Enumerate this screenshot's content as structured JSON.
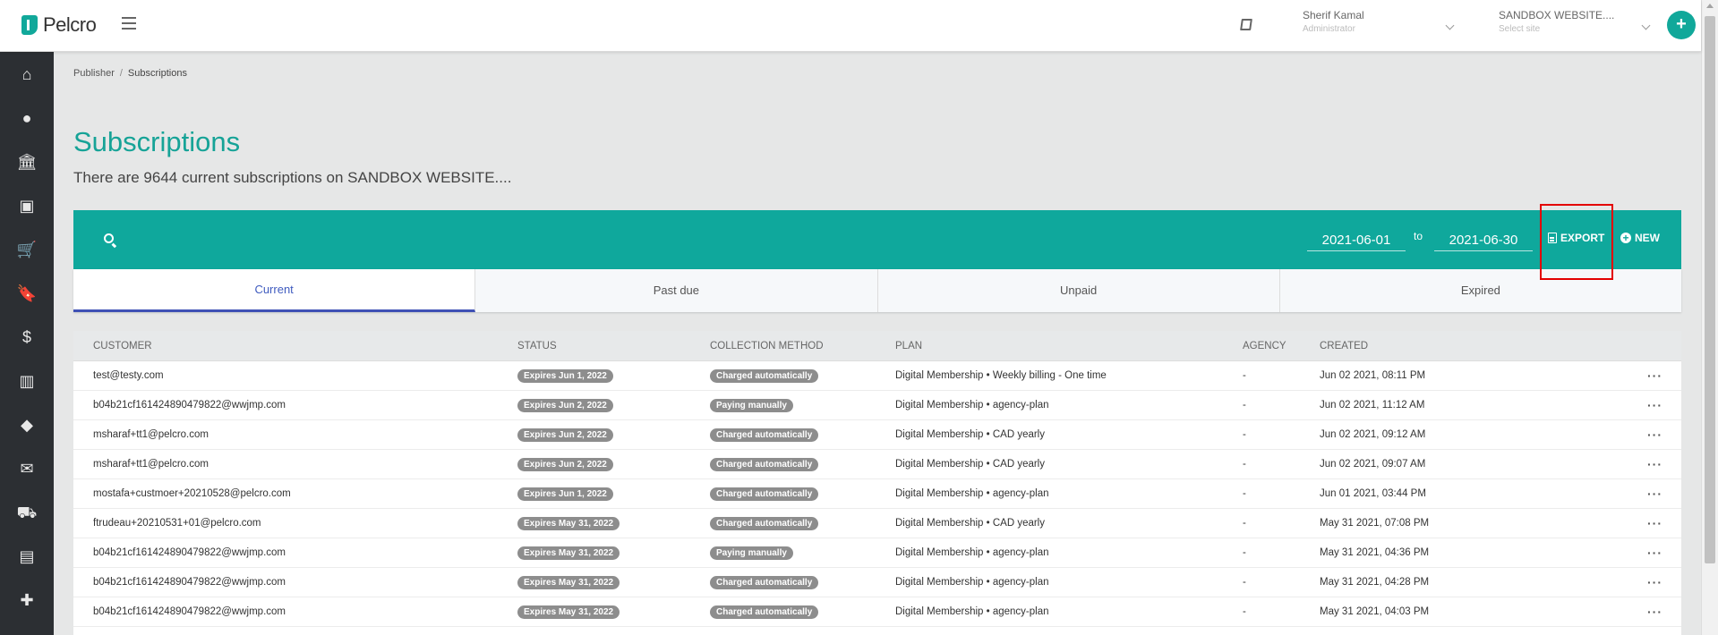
{
  "app": {
    "logo_text": "Pelcro"
  },
  "header": {
    "user_name": "Sherif Kamal",
    "user_role": "Administrator",
    "site_name": "SANDBOX WEBSITE....",
    "site_placeholder": "Select site",
    "add_label": "+"
  },
  "sidebar": {
    "items": [
      {
        "name": "home",
        "glyph": "⌂"
      },
      {
        "name": "user",
        "glyph": "●"
      },
      {
        "name": "bank",
        "glyph": "🏛"
      },
      {
        "name": "briefcase",
        "glyph": "▣"
      },
      {
        "name": "cart",
        "glyph": "🛒"
      },
      {
        "name": "bookmark",
        "glyph": "🔖"
      },
      {
        "name": "dollar",
        "glyph": "$"
      },
      {
        "name": "chart",
        "glyph": "▥"
      },
      {
        "name": "tag",
        "glyph": "◆"
      },
      {
        "name": "mail",
        "glyph": "✉"
      },
      {
        "name": "truck",
        "glyph": "⛟"
      },
      {
        "name": "store",
        "glyph": "▤"
      },
      {
        "name": "puzzle",
        "glyph": "✚"
      }
    ]
  },
  "breadcrumb": {
    "parent": "Publisher",
    "separator": "/",
    "current": "Subscriptions"
  },
  "page": {
    "title": "Subscriptions",
    "subtitle": "There are 9644 current subscriptions on SANDBOX WEBSITE...."
  },
  "toolbar": {
    "date_from": "2021-06-01",
    "to_label": "to",
    "date_to": "2021-06-30",
    "export_label": "EXPORT",
    "new_label": "NEW"
  },
  "tabs": [
    {
      "label": "Current",
      "active": true
    },
    {
      "label": "Past due",
      "active": false
    },
    {
      "label": "Unpaid",
      "active": false
    },
    {
      "label": "Expired",
      "active": false
    }
  ],
  "table": {
    "headers": {
      "customer": "CUSTOMER",
      "status": "STATUS",
      "method": "COLLECTION METHOD",
      "plan": "PLAN",
      "agency": "AGENCY",
      "created": "CREATED"
    },
    "rows": [
      {
        "customer": "test@testy.com",
        "status": "Expires Jun 1, 2022",
        "method": "Charged automatically",
        "plan": "Digital Membership • Weekly billing - One time",
        "agency": "-",
        "created": "Jun 02 2021, 08:11 PM"
      },
      {
        "customer": "b04b21cf161424890479822@wwjmp.com",
        "status": "Expires Jun 2, 2022",
        "method": "Paying manually",
        "plan": "Digital Membership • agency-plan",
        "agency": "-",
        "created": "Jun 02 2021, 11:12 AM"
      },
      {
        "customer": "msharaf+tt1@pelcro.com",
        "status": "Expires Jun 2, 2022",
        "method": "Charged automatically",
        "plan": "Digital Membership • CAD yearly",
        "agency": "-",
        "created": "Jun 02 2021, 09:12 AM"
      },
      {
        "customer": "msharaf+tt1@pelcro.com",
        "status": "Expires Jun 2, 2022",
        "method": "Charged automatically",
        "plan": "Digital Membership • CAD yearly",
        "agency": "-",
        "created": "Jun 02 2021, 09:07 AM"
      },
      {
        "customer": "mostafa+custmoer+20210528@pelcro.com",
        "status": "Expires Jun 1, 2022",
        "method": "Charged automatically",
        "plan": "Digital Membership • agency-plan",
        "agency": "-",
        "created": "Jun 01 2021, 03:44 PM"
      },
      {
        "customer": "ftrudeau+20210531+01@pelcro.com",
        "status": "Expires May 31, 2022",
        "method": "Charged automatically",
        "plan": "Digital Membership • CAD yearly",
        "agency": "-",
        "created": "May 31 2021, 07:08 PM"
      },
      {
        "customer": "b04b21cf161424890479822@wwjmp.com",
        "status": "Expires May 31, 2022",
        "method": "Paying manually",
        "plan": "Digital Membership • agency-plan",
        "agency": "-",
        "created": "May 31 2021, 04:36 PM"
      },
      {
        "customer": "b04b21cf161424890479822@wwjmp.com",
        "status": "Expires May 31, 2022",
        "method": "Charged automatically",
        "plan": "Digital Membership • agency-plan",
        "agency": "-",
        "created": "May 31 2021, 04:28 PM"
      },
      {
        "customer": "b04b21cf161424890479822@wwjmp.com",
        "status": "Expires May 31, 2022",
        "method": "Charged automatically",
        "plan": "Digital Membership • agency-plan",
        "agency": "-",
        "created": "May 31 2021, 04:03 PM"
      }
    ],
    "row_action_glyph": "···"
  },
  "colors": {
    "brand": "#11a89a",
    "toolbar": "#0fa89c",
    "active_tab": "#3f51b5",
    "badge": "#8d8d8d",
    "highlight": "#e30000"
  }
}
